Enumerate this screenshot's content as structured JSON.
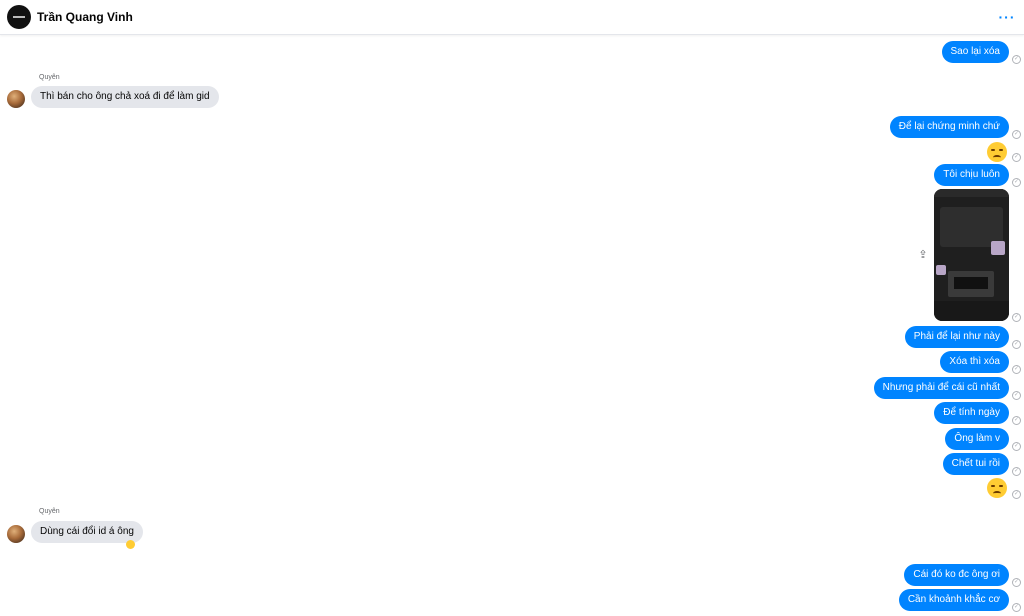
{
  "header": {
    "contact_name": "Trần Quang Vinh",
    "avatar_icon": "profile-avatar",
    "more_icon": "more-options-icon",
    "more_glyph": "···"
  },
  "colors": {
    "outgoing": "#0084ff",
    "incoming": "#e4e6eb",
    "accent": "#0084ff"
  },
  "thread": {
    "sender_name": "Quyên",
    "read_glyph": "✓",
    "share_glyph": "⇪",
    "messages": [
      {
        "dir": "out",
        "text": "Sao lại xóa"
      },
      {
        "dir": "in",
        "text": "Thì bán cho ông chả xoá đi để làm gid"
      },
      {
        "dir": "out",
        "text": "Để lại chứng minh chứ"
      },
      {
        "dir": "out",
        "emoji": "disappointed-face-emoji"
      },
      {
        "dir": "out",
        "text": "Tôi chịu luôn"
      },
      {
        "dir": "out",
        "image": "screenshot-photo"
      },
      {
        "dir": "out",
        "text": "Phải để lại như này"
      },
      {
        "dir": "out",
        "text": "Xóa thì xóa"
      },
      {
        "dir": "out",
        "text": "Nhưng phải để cái cũ nhất"
      },
      {
        "dir": "out",
        "text": "Để tính ngày"
      },
      {
        "dir": "out",
        "text": "Ông làm v"
      },
      {
        "dir": "out",
        "text": "Chết tui rồi"
      },
      {
        "dir": "out",
        "emoji": "frowning-face-emoji"
      },
      {
        "dir": "in",
        "text": "Dùng cái đổi id á ông",
        "reaction": "crying-face-emoji"
      },
      {
        "dir": "out",
        "text": "Cái đó ko đc ông ơi"
      },
      {
        "dir": "out",
        "text": "Cần khoảnh khắc cơ"
      }
    ]
  }
}
